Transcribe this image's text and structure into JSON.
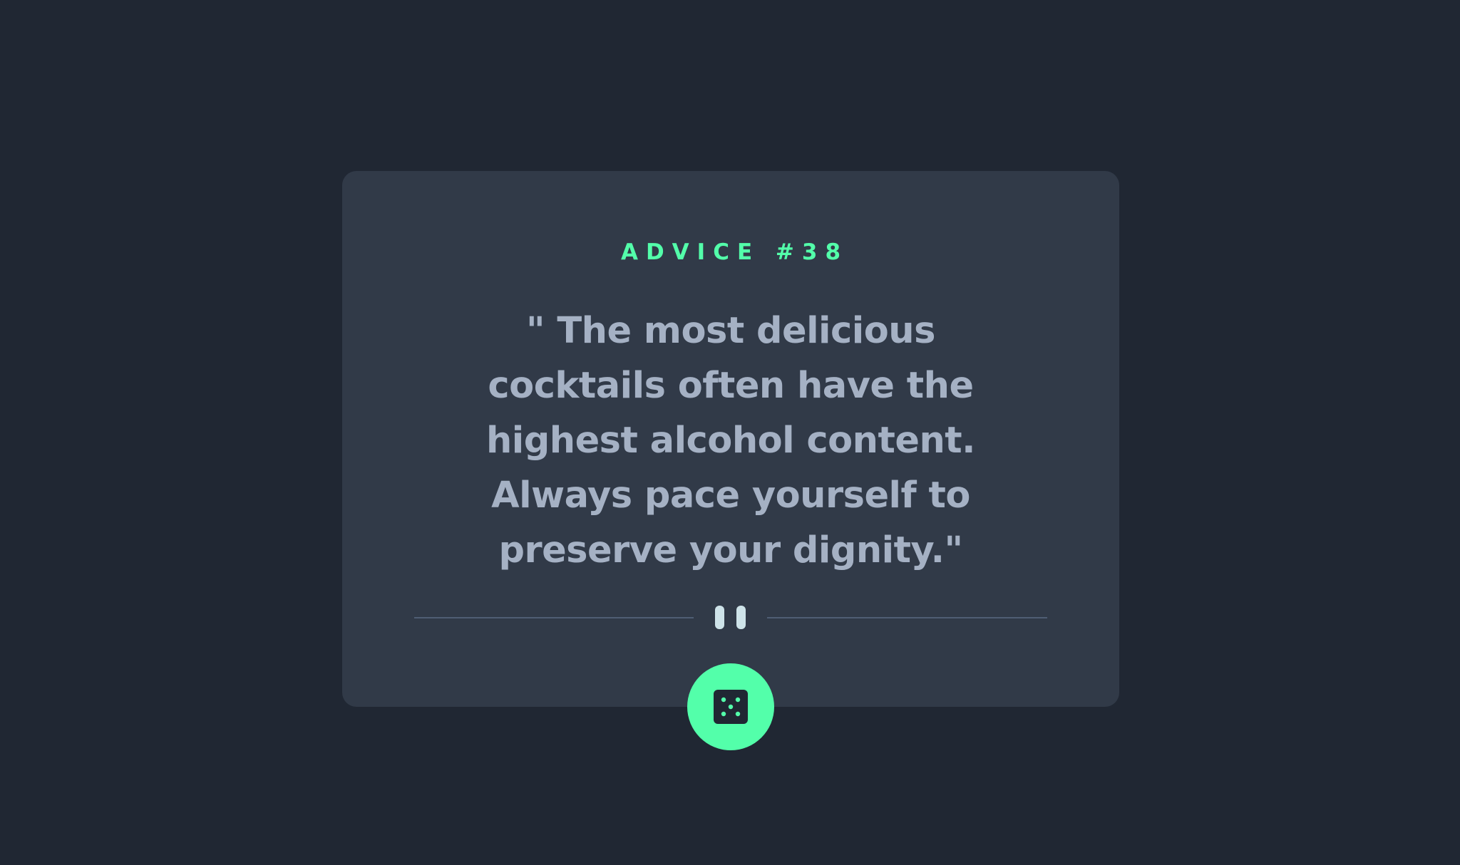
{
  "advice": {
    "label": "ADVICE #38",
    "text": "\" The most delicious cocktails often have the highest alcohol content. Always pace yourself to preserve your dignity.\""
  },
  "divider": {
    "icon": "pause-icon"
  },
  "button": {
    "icon": "dice-icon"
  },
  "colors": {
    "background": "#202733",
    "card": "#313a48",
    "accent": "#53ffaa",
    "text": "#a5b1c4",
    "divider": "#4f5d74",
    "pause": "#cee3e9"
  }
}
